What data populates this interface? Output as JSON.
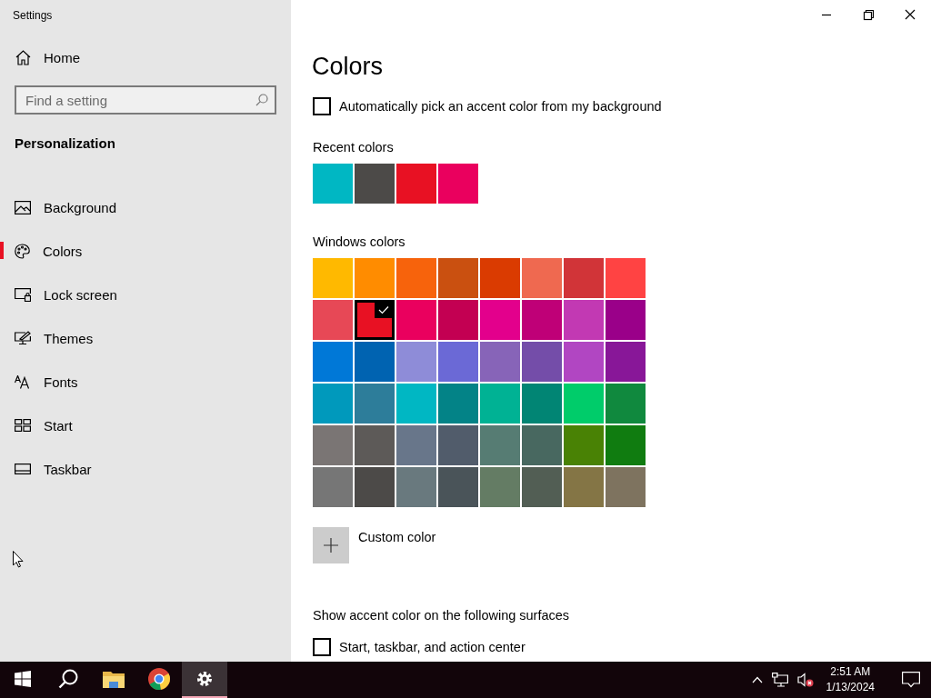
{
  "window": {
    "title": "Settings"
  },
  "sidebar": {
    "home": "Home",
    "search": {
      "placeholder": "Find a setting"
    },
    "section": "Personalization",
    "items": [
      {
        "label": "Background",
        "selected": false
      },
      {
        "label": "Colors",
        "selected": true
      },
      {
        "label": "Lock screen",
        "selected": false
      },
      {
        "label": "Themes",
        "selected": false
      },
      {
        "label": "Fonts",
        "selected": false
      },
      {
        "label": "Start",
        "selected": false
      },
      {
        "label": "Taskbar",
        "selected": false
      }
    ]
  },
  "main": {
    "title": "Colors",
    "auto_pick": {
      "label": "Automatically pick an accent color from my background",
      "checked": false
    },
    "recent": {
      "heading": "Recent colors",
      "swatches": [
        {
          "color": "#00b7c3"
        },
        {
          "color": "#4c4a48"
        },
        {
          "color": "#e81123"
        },
        {
          "color": "#ea005e"
        }
      ]
    },
    "windows_colors": {
      "heading": "Windows colors",
      "swatches": [
        {
          "color": "#ffb900",
          "selected": false
        },
        {
          "color": "#ff8c00",
          "selected": false
        },
        {
          "color": "#f7630c",
          "selected": false
        },
        {
          "color": "#ca5010",
          "selected": false
        },
        {
          "color": "#da3b01",
          "selected": false
        },
        {
          "color": "#ef6950",
          "selected": false
        },
        {
          "color": "#d13438",
          "selected": false
        },
        {
          "color": "#ff4343",
          "selected": false
        },
        {
          "color": "#e74856",
          "selected": false
        },
        {
          "color": "#e81123",
          "selected": true
        },
        {
          "color": "#ea005e",
          "selected": false
        },
        {
          "color": "#c30052",
          "selected": false
        },
        {
          "color": "#e3008c",
          "selected": false
        },
        {
          "color": "#bf0077",
          "selected": false
        },
        {
          "color": "#c239b3",
          "selected": false
        },
        {
          "color": "#9a0089",
          "selected": false
        },
        {
          "color": "#0078d7",
          "selected": false
        },
        {
          "color": "#0063b1",
          "selected": false
        },
        {
          "color": "#8e8cd8",
          "selected": false
        },
        {
          "color": "#6b69d6",
          "selected": false
        },
        {
          "color": "#8764b8",
          "selected": false
        },
        {
          "color": "#744da9",
          "selected": false
        },
        {
          "color": "#b146c2",
          "selected": false
        },
        {
          "color": "#881798",
          "selected": false
        },
        {
          "color": "#0099bc",
          "selected": false
        },
        {
          "color": "#2d7d9a",
          "selected": false
        },
        {
          "color": "#00b7c3",
          "selected": false
        },
        {
          "color": "#038387",
          "selected": false
        },
        {
          "color": "#00b294",
          "selected": false
        },
        {
          "color": "#018574",
          "selected": false
        },
        {
          "color": "#00cc6a",
          "selected": false
        },
        {
          "color": "#10893e",
          "selected": false
        },
        {
          "color": "#7a7574",
          "selected": false
        },
        {
          "color": "#5d5a58",
          "selected": false
        },
        {
          "color": "#68768a",
          "selected": false
        },
        {
          "color": "#515c6b",
          "selected": false
        },
        {
          "color": "#567c73",
          "selected": false
        },
        {
          "color": "#486860",
          "selected": false
        },
        {
          "color": "#498205",
          "selected": false
        },
        {
          "color": "#107c10",
          "selected": false
        },
        {
          "color": "#767676",
          "selected": false
        },
        {
          "color": "#4c4a48",
          "selected": false
        },
        {
          "color": "#69797e",
          "selected": false
        },
        {
          "color": "#4a5459",
          "selected": false
        },
        {
          "color": "#647c64",
          "selected": false
        },
        {
          "color": "#525e54",
          "selected": false
        },
        {
          "color": "#847545",
          "selected": false
        },
        {
          "color": "#7e735f",
          "selected": false
        }
      ]
    },
    "custom": {
      "label": "Custom color"
    },
    "surfaces": {
      "heading": "Show accent color on the following surfaces",
      "options": [
        {
          "label": "Start, taskbar, and action center",
          "checked": false
        }
      ]
    }
  },
  "taskbar": {
    "apps": [
      {
        "selected": false
      },
      {
        "selected": false
      },
      {
        "selected": false
      },
      {
        "selected": false
      },
      {
        "selected": true
      }
    ],
    "time": "2:51 AM",
    "date": "1/13/2024"
  }
}
